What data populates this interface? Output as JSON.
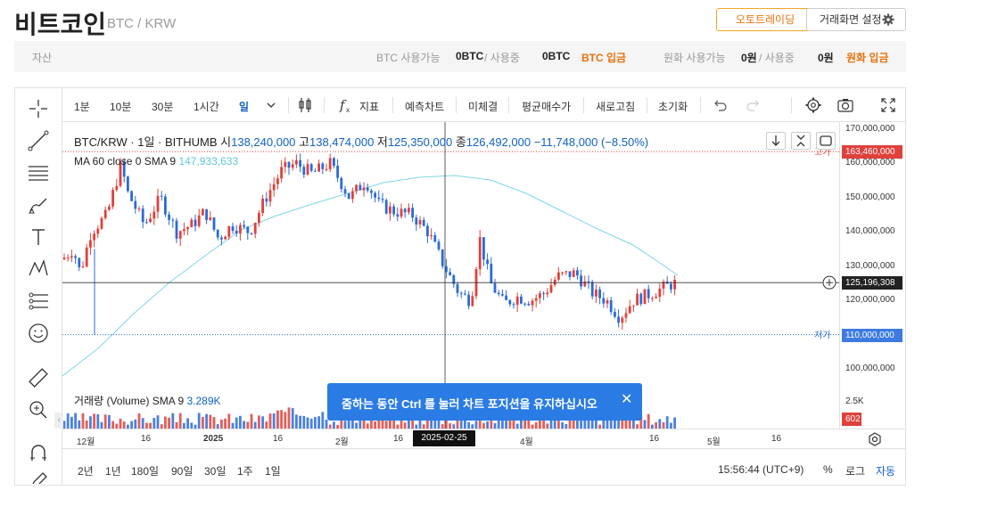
{
  "header": {
    "title": "비트코인",
    "subtitle": "BTC / KRW",
    "otc_button": "오토트레이딩",
    "settings_button": "거래화면 설정"
  },
  "assets": {
    "label": "자산",
    "btc_avail_label": "BTC 사용가능",
    "btc_avail": "0BTC",
    "btc_used_label": "/ 사용중",
    "btc_used": "0BTC",
    "btc_deposit": "BTC 입금",
    "krw_avail_label": "원화 사용가능",
    "krw_avail": "0원",
    "krw_used_label": "/ 사용중",
    "krw_used": "0원",
    "krw_deposit": "원화 입금"
  },
  "toolbar": {
    "intervals": [
      "1분",
      "10분",
      "30분",
      "1시간",
      "일"
    ],
    "active": "일",
    "indicator": "지표",
    "forecast": "예측차트",
    "unfilled": "미체결",
    "avg_price": "평균매수가",
    "refresh": "새로고침",
    "reset": "초기화"
  },
  "info": {
    "symbol": "BTC/KRW · 1일 · BITHUMB",
    "open_label": "시",
    "open": "138,240,000",
    "high_label": "고",
    "high": "138,474,000",
    "low_label": "저",
    "low": "125,350,000",
    "close_label": "종",
    "close": "126,492,000",
    "change": "−11,748,000 (−8.50%)",
    "ma_label": "MA 60 close 0 SMA 9",
    "ma_value": "147,933,633",
    "volume_label": "거래량 (Volume) SMA 9",
    "volume_value": "3.289K"
  },
  "yaxis": {
    "ticks": [
      "170,000,000",
      "160,000,000",
      "150,000,000",
      "140,000,000",
      "130,000,000",
      "120,000,000",
      "100,000,000"
    ],
    "high_marker": "163,460,000",
    "high_text": "고가",
    "current": "125,196,308",
    "low_marker": "110,000,000",
    "low_text": "저가",
    "vol_tick": "2.5K",
    "vol_current": "602"
  },
  "xaxis": {
    "ticks": [
      "12월",
      "16",
      "2025",
      "16",
      "2월",
      "16",
      "4월",
      "16",
      "5월",
      "16"
    ],
    "cursor": "2025-02-25"
  },
  "bottom": {
    "ranges": [
      "2년",
      "1년",
      "180일",
      "90일",
      "30일",
      "1주",
      "1일"
    ],
    "time": "15:56:44 (UTC+9)",
    "percent": "%",
    "log": "로그",
    "auto": "자동"
  },
  "toast": {
    "message": "줌하는 동안 Ctrl 를 눌러 차트 포지션을 유지하십시오"
  },
  "colors": {
    "up": "#e0413b",
    "down": "#2a6bd8",
    "ma": "#7fd6e6",
    "accent": "#1261c4",
    "orange": "#e8710a"
  }
}
